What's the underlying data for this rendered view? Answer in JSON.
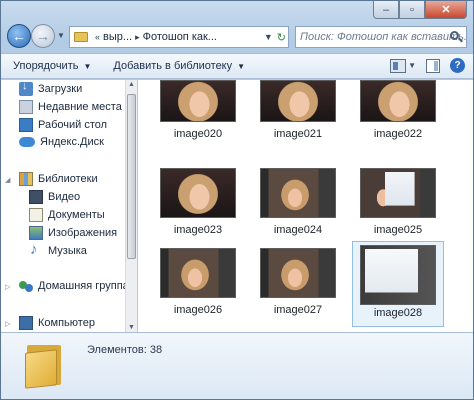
{
  "address": {
    "segments": [
      "выр...",
      "Фотошоп как..."
    ]
  },
  "search": {
    "placeholder": "Поиск: Фотошоп как вставить..."
  },
  "toolbar": {
    "organize": "Упорядочить",
    "add_to_library": "Добавить в библиотеку"
  },
  "nav_pane": {
    "favorites": [
      {
        "label": "Загрузки",
        "icon": "downloads-icon"
      },
      {
        "label": "Недавние места",
        "icon": "recent-places-icon"
      },
      {
        "label": "Рабочий стол",
        "icon": "desktop-icon"
      },
      {
        "label": "Яндекс.Диск",
        "icon": "yandex-disk-icon"
      }
    ],
    "libraries": {
      "label": "Библиотеки",
      "items": [
        {
          "label": "Видео",
          "icon": "video-icon"
        },
        {
          "label": "Документы",
          "icon": "documents-icon"
        },
        {
          "label": "Изображения",
          "icon": "images-icon"
        },
        {
          "label": "Музыка",
          "icon": "music-icon"
        }
      ]
    },
    "homegroup": {
      "label": "Домашняя группа"
    },
    "computer": {
      "label": "Компьютер"
    }
  },
  "files": [
    {
      "name": "image020",
      "kind": "face"
    },
    {
      "name": "image021",
      "kind": "face"
    },
    {
      "name": "image022",
      "kind": "face"
    },
    {
      "name": "image023",
      "kind": "face"
    },
    {
      "name": "image024",
      "kind": "ps"
    },
    {
      "name": "image025",
      "kind": "dialog"
    },
    {
      "name": "image026",
      "kind": "ps"
    },
    {
      "name": "image027",
      "kind": "ps"
    },
    {
      "name": "image028",
      "kind": "big-dialog",
      "selected": true
    }
  ],
  "details": {
    "item_count": "Элементов: 38"
  },
  "colors": {
    "window_chrome": "#b3cbe4",
    "selection": "#e8f2fb",
    "close_button": "#c8472e"
  }
}
